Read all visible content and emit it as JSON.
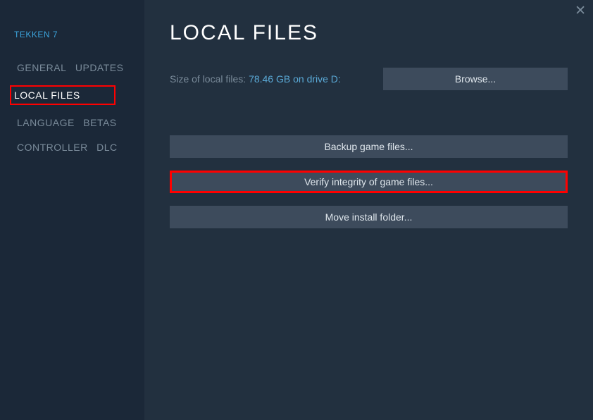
{
  "sidebar": {
    "game_title": "TEKKEN 7",
    "items": [
      {
        "label": "GENERAL"
      },
      {
        "label": "UPDATES"
      },
      {
        "label": "LOCAL FILES"
      },
      {
        "label": "LANGUAGE"
      },
      {
        "label": "BETAS"
      },
      {
        "label": "CONTROLLER"
      },
      {
        "label": "DLC"
      }
    ]
  },
  "main": {
    "title": "LOCAL FILES",
    "size_label": "Size of local files: ",
    "size_value": "78.46 GB on drive D:",
    "browse_label": "Browse...",
    "backup_label": "Backup game files...",
    "verify_label": "Verify integrity of game files...",
    "move_label": "Move install folder..."
  }
}
